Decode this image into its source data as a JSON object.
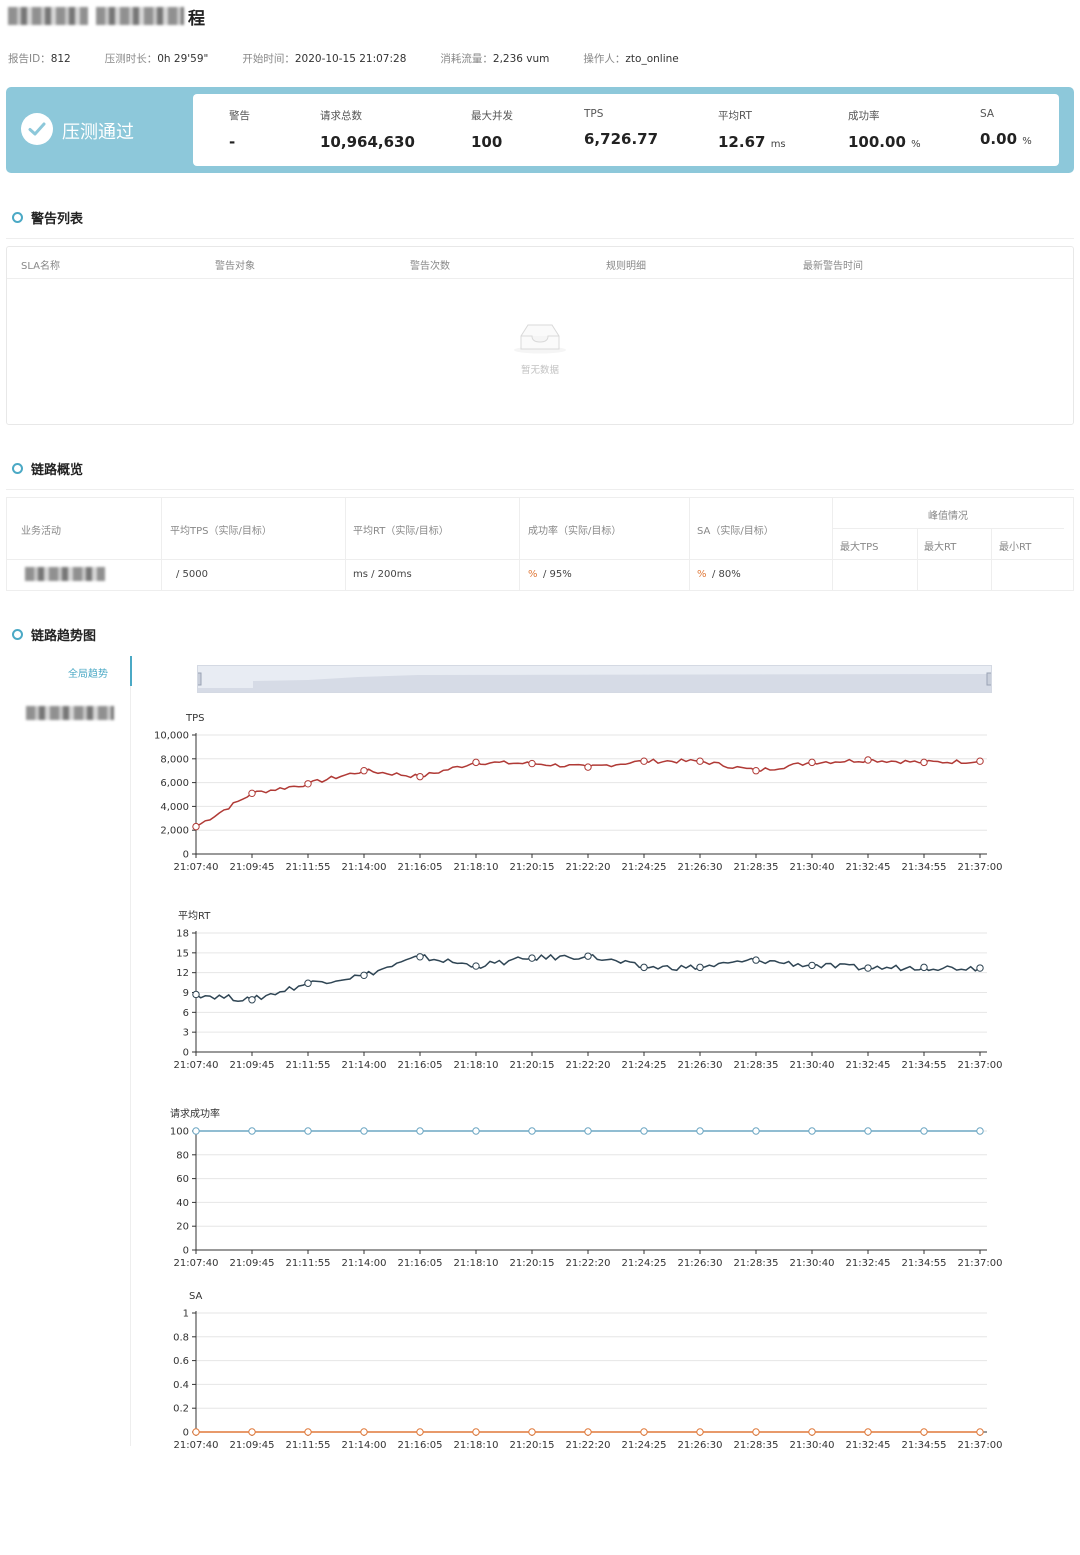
{
  "header": {
    "title_suffix": "程"
  },
  "meta": [
    {
      "label": "报告ID：",
      "value": "812"
    },
    {
      "label": "压测时长：",
      "value": "0h 29'59\""
    },
    {
      "label": "开始时间：",
      "value": "2020-10-15 21:07:28"
    },
    {
      "label": "消耗流量：",
      "value": "2,236 vum"
    },
    {
      "label": "操作人：",
      "value": "zto_online"
    }
  ],
  "banner": {
    "status": "压测通过",
    "stats": [
      {
        "label": "警告",
        "value": "-",
        "unit": ""
      },
      {
        "label": "请求总数",
        "value": "10,964,630",
        "unit": ""
      },
      {
        "label": "最大并发",
        "value": "100",
        "unit": ""
      },
      {
        "label": "TPS",
        "value": "6,726.77",
        "unit": ""
      },
      {
        "label": "平均RT",
        "value": "12.67",
        "unit": "ms"
      },
      {
        "label": "成功率",
        "value": "100.00",
        "unit": "%"
      },
      {
        "label": "SA",
        "value": "0.00",
        "unit": "%"
      }
    ]
  },
  "alerts": {
    "section_title": "警告列表",
    "columns": [
      "SLA名称",
      "警告对象",
      "警告次数",
      "规则明细",
      "最新警告时间"
    ],
    "empty_text": "暂无数据"
  },
  "overview": {
    "section_title": "链路概览",
    "columns": [
      "业务活动",
      "平均TPS（实际/目标）",
      "平均RT（实际/目标）",
      "成功率（实际/目标）",
      "SA（实际/目标）"
    ],
    "peak_header": "峰值情况",
    "peak_columns": [
      "最大TPS",
      "最大RT",
      "最小RT"
    ],
    "row": {
      "tps": "/  5000",
      "rt": "ms  /  200ms",
      "success_unit": "%",
      "success_target": "/  95%",
      "sa_unit": "%",
      "sa_target": "/  80%"
    }
  },
  "trend": {
    "section_title": "链路趋势图",
    "tabs": [
      "全局趋势"
    ]
  },
  "colors": {
    "accent": "#4ba9c5",
    "banner": "#8dc8da",
    "tps_line": "#b03a36",
    "rt_line": "#2f4554",
    "success_line": "#6da7c3",
    "sa_line": "#e0793a",
    "warn": "#e0793a"
  },
  "chart_data": [
    {
      "type": "line",
      "title": "TPS",
      "x": [
        "21:07:40",
        "21:09:45",
        "21:11:55",
        "21:14:00",
        "21:16:05",
        "21:18:10",
        "21:20:15",
        "21:22:20",
        "21:24:25",
        "21:26:30",
        "21:28:35",
        "21:30:40",
        "21:32:45",
        "21:34:55",
        "21:37:00"
      ],
      "ylim": [
        0,
        10000
      ],
      "yticks": [
        "0",
        "2,000",
        "4,000",
        "6,000",
        "8,000",
        "10,000"
      ],
      "series": [
        {
          "values": [
            2300,
            5100,
            5900,
            7000,
            6500,
            7700,
            7600,
            7300,
            7800,
            7800,
            7000,
            7700,
            7900,
            7700,
            7800
          ]
        }
      ]
    },
    {
      "type": "line",
      "title": "平均RT",
      "x": [
        "21:07:40",
        "21:09:45",
        "21:11:55",
        "21:14:00",
        "21:16:05",
        "21:18:10",
        "21:20:15",
        "21:22:20",
        "21:24:25",
        "21:26:30",
        "21:28:35",
        "21:30:40",
        "21:32:45",
        "21:34:55",
        "21:37:00"
      ],
      "ylim": [
        0,
        18
      ],
      "yticks": [
        "0",
        "3",
        "6",
        "9",
        "12",
        "15",
        "18"
      ],
      "series": [
        {
          "values": [
            8.7,
            7.9,
            10.4,
            11.6,
            14.4,
            13.0,
            14.2,
            14.5,
            12.8,
            12.8,
            13.9,
            13.1,
            12.7,
            12.8,
            12.7
          ]
        }
      ]
    },
    {
      "type": "line",
      "title": "请求成功率",
      "x": [
        "21:07:40",
        "21:09:45",
        "21:11:55",
        "21:14:00",
        "21:16:05",
        "21:18:10",
        "21:20:15",
        "21:22:20",
        "21:24:25",
        "21:26:30",
        "21:28:35",
        "21:30:40",
        "21:32:45",
        "21:34:55",
        "21:37:00"
      ],
      "ylim": [
        0,
        100
      ],
      "yticks": [
        "0",
        "20",
        "40",
        "60",
        "80",
        "100"
      ],
      "series": [
        {
          "values": [
            100,
            100,
            100,
            100,
            100,
            100,
            100,
            100,
            100,
            100,
            100,
            100,
            100,
            100,
            100
          ]
        }
      ]
    },
    {
      "type": "line",
      "title": "SA",
      "x": [
        "21:07:40",
        "21:09:45",
        "21:11:55",
        "21:14:00",
        "21:16:05",
        "21:18:10",
        "21:20:15",
        "21:22:20",
        "21:24:25",
        "21:26:30",
        "21:28:35",
        "21:30:40",
        "21:32:45",
        "21:34:55",
        "21:37:00"
      ],
      "ylim": [
        0,
        1
      ],
      "yticks": [
        "0",
        "0.2",
        "0.4",
        "0.6",
        "0.8",
        "1"
      ],
      "series": [
        {
          "values": [
            0,
            0,
            0,
            0,
            0,
            0,
            0,
            0,
            0,
            0,
            0,
            0,
            0,
            0,
            0
          ]
        }
      ]
    }
  ]
}
